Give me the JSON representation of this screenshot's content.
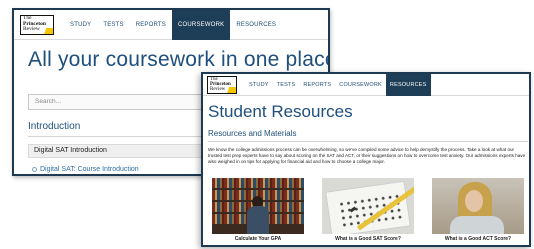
{
  "back_window": {
    "logo": {
      "line1": "The",
      "line2": "Princeton",
      "line3": "Review"
    },
    "nav": [
      "STUDY",
      "TESTS",
      "REPORTS",
      "COURSEWORK",
      "RESOURCES"
    ],
    "active_nav": "COURSEWORK",
    "title": "All your coursework in one place.",
    "search_placeholder": "Search...",
    "section_heading": "Introduction",
    "course_group": "Digital SAT Introduction",
    "course_link": "Digital SAT: Course Introduction"
  },
  "front_window": {
    "logo": {
      "line1": "The",
      "line2": "Princeton",
      "line3": "Review"
    },
    "nav": [
      "STUDY",
      "TESTS",
      "REPORTS",
      "COURSEWORK",
      "RESOURCES"
    ],
    "active_nav": "RESOURCES",
    "title": "Student Resources",
    "subtitle": "Resources and Materials",
    "body": "We know the college admissions process can be overwhelming, so we've compiled some advice to help demystify the process. Take a look at what our trusted test prep experts have to say about scoring on the SAT and ACT, or their suggestions on how to overcome test anxiety. Our admissions experts have also weighed in on tips for applying for financial aid and how to choose a college major.",
    "cards": [
      {
        "caption": "Calculate Your GPA",
        "image": "library-photo"
      },
      {
        "caption": "What is a Good SAT Score?",
        "image": "exam-sheet-photo"
      },
      {
        "caption": "What is a Good ACT Score?",
        "image": "student-photo"
      }
    ]
  },
  "colors": {
    "brand_navy": "#1e3d57",
    "heading_blue": "#1e4f7d",
    "logo_yellow": "#f6c700",
    "link_blue": "#2b6ea8"
  }
}
